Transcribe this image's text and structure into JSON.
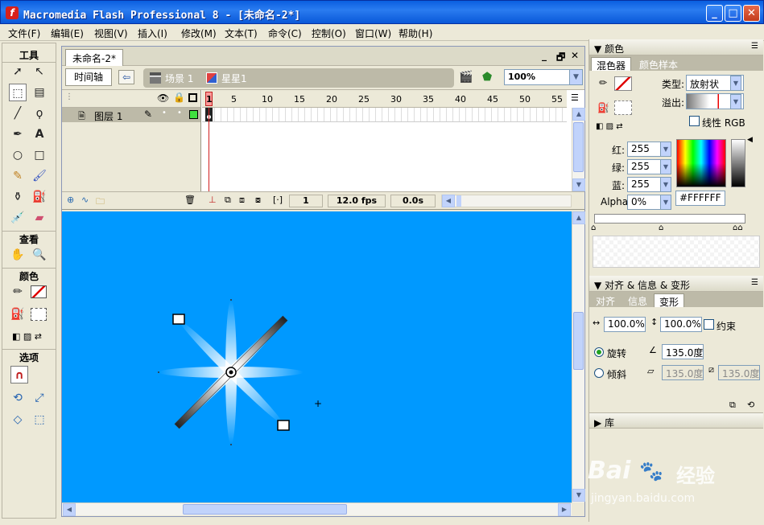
{
  "window": {
    "title": "Macromedia Flash Professional 8 - [未命名-2*]",
    "controls": [
      "_",
      "□",
      "✕"
    ]
  },
  "menu": [
    "文件(F)",
    "编辑(E)",
    "视图(V)",
    "插入(I)",
    "修改(M)",
    "文本(T)",
    "命令(C)",
    "控制(O)",
    "窗口(W)",
    "帮助(H)"
  ],
  "tools": {
    "title": "工具",
    "view_title": "查看",
    "color_title": "颜色",
    "options_title": "选项"
  },
  "document": {
    "tab_title": "未命名-2*",
    "controls": [
      "_",
      "🗗",
      "✕"
    ],
    "timeline_button": "时间轴",
    "scene": "场景 1",
    "symbol": "星星1",
    "zoom": "100%"
  },
  "timeline": {
    "frame_numbers": [
      "1",
      "5",
      "10",
      "15",
      "20",
      "25",
      "30",
      "35",
      "40",
      "45",
      "50",
      "55"
    ],
    "layer_name": "图层 1",
    "current_frame": "1",
    "fps": "12.0 fps",
    "time": "0.0s"
  },
  "colors": {
    "stage": "#0099ff",
    "accent": "#0a5fe0"
  },
  "color_panel": {
    "title": "颜色",
    "tabs": [
      "混色器",
      "颜色样本"
    ],
    "type_label": "类型:",
    "type_value": "放射状",
    "overflow_label": "溢出:",
    "linear_rgb": "线性 RGB",
    "red_label": "红:",
    "red": "255",
    "green_label": "绿:",
    "green": "255",
    "blue_label": "蓝:",
    "blue": "255",
    "alpha_label": "Alpha:",
    "alpha": "0%",
    "hex": "#FFFFFF"
  },
  "transform_panel": {
    "title": "对齐 & 信息 & 变形",
    "tabs": [
      "对齐",
      "信息",
      "变形"
    ],
    "width_scale": "100.0%",
    "height_scale": "100.0%",
    "constrain": "约束",
    "rotate_label": "旋转",
    "rotate_value": "135.0度",
    "skew_label": "倾斜",
    "skew_h": "135.0度",
    "skew_v": "135.0度"
  },
  "library_panel": {
    "title": "库"
  },
  "watermark": {
    "brand": "Bai",
    "brand2": "经验",
    "url": "jingyan.baidu.com"
  }
}
